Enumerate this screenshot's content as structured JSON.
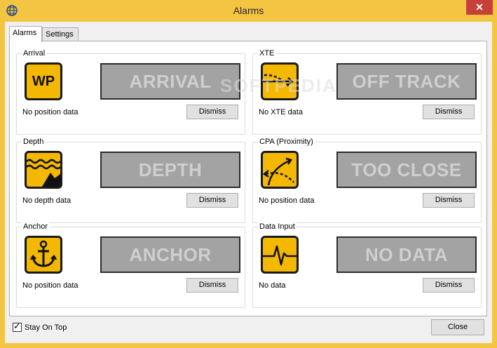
{
  "window": {
    "title": "Alarms",
    "close_glyph": "✕"
  },
  "tabs": [
    {
      "label": "Alarms"
    },
    {
      "label": "Settings"
    }
  ],
  "watermark": "SOFTPEDIA",
  "alarms": {
    "arrival": {
      "group": "Arrival",
      "icon_text": "WP",
      "display": "ARRIVAL",
      "status": "No position data",
      "button": "Dismiss"
    },
    "xte": {
      "group": "XTE",
      "display": "OFF TRACK",
      "status": "No XTE data",
      "button": "Dismiss"
    },
    "depth": {
      "group": "Depth",
      "display": "DEPTH",
      "status": "No depth data",
      "button": "Dismiss"
    },
    "cpa": {
      "group": "CPA (Proximity)",
      "display": "TOO CLOSE",
      "status": "No position data",
      "button": "Dismiss"
    },
    "anchor": {
      "group": "Anchor",
      "display": "ANCHOR",
      "status": "No position data",
      "button": "Dismiss"
    },
    "data_input": {
      "group": "Data Input",
      "display": "NO DATA",
      "status": "No data",
      "button": "Dismiss"
    }
  },
  "footer": {
    "stay_on_top_label": "Stay On Top",
    "stay_on_top_checked": true,
    "check_glyph": "✓",
    "close_label": "Close"
  },
  "colors": {
    "titlebar": "#f4c542",
    "icon_bg": "#f5b800",
    "display_bg": "#a3a3a3",
    "display_text": "#cfcfcf",
    "close_button": "#c7403a"
  }
}
